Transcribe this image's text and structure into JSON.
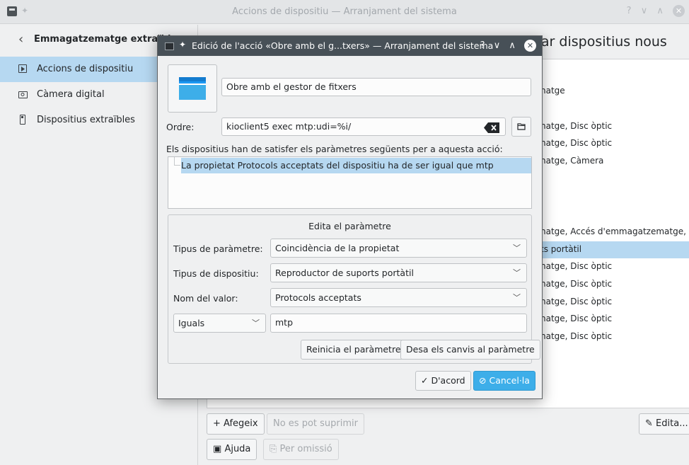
{
  "window": {
    "title": "Accions de dispositiu — Arranjament del sistema",
    "controls": {
      "help": "?",
      "minimize": "∨",
      "maximize": "∧",
      "close": "✕"
    }
  },
  "sidebar": {
    "back_title": "Emmagatzematge extraïble",
    "items": [
      {
        "label": "Accions de dispositiu",
        "selected": true
      },
      {
        "label": "Càmera digital",
        "selected": false
      },
      {
        "label": "Dispositius extraïbles",
        "selected": false
      }
    ]
  },
  "content": {
    "title": "ttar dispositius nous",
    "rows": [
      {
        "text": "natge",
        "selected": false
      },
      {
        "text": "natge, Disc òptic",
        "selected": false
      },
      {
        "text": "natge, Disc òptic",
        "selected": false
      },
      {
        "text": "natge, Càmera",
        "selected": false
      },
      {
        "text": "natge, Accés d'emmagatzematge, ...",
        "selected": false
      },
      {
        "text": "ts portàtil",
        "selected": true
      },
      {
        "text": "natge, Disc òptic",
        "selected": false
      },
      {
        "text": "natge, Disc òptic",
        "selected": false
      },
      {
        "text": "natge, Disc òptic",
        "selected": false
      },
      {
        "text": "natge, Disc òptic",
        "selected": false
      },
      {
        "text": "natge, Disc òptic",
        "selected": false
      }
    ],
    "buttons": {
      "add": "Afegeix",
      "cannot_delete": "No es pot suprimir",
      "edit": "Edita...",
      "help": "Ajuda",
      "defaults": "Per omissió"
    }
  },
  "dialog": {
    "title": "Edició de l'acció «Obre amb el g...txers» — Arranjament del sistema",
    "controls": {
      "help": "?",
      "minimize": "∨",
      "maximize": "∧",
      "close": "✕"
    },
    "action_name": "Obre amb el gestor de fitxers",
    "command_label": "Ordre:",
    "command_value": "kioclient5 exec mtp:udi=%i/",
    "conditions_label": "Els dispositius han de satisfer els paràmetres següents per a aquesta acció:",
    "condition_item": "La propietat Protocols acceptats del dispositiu ha de ser igual que mtp",
    "edit_group_title": "Edita el paràmetre",
    "param_type_label": "Tipus de paràmetre:",
    "param_type_value": "Coincidència de la propietat",
    "device_type_label": "Tipus de dispositiu:",
    "device_type_value": "Reproductor de suports portàtil",
    "value_name_label": "Nom del valor:",
    "value_name_value": "Protocols acceptats",
    "comparison_value": "Iguals",
    "match_value": "mtp",
    "reset_button": "Reinicia el paràmetre",
    "save_button": "Desa els canvis al paràmetre",
    "ok_button": "D'acord",
    "cancel_button": "Cancel·la"
  },
  "colors": {
    "selection": "#b6d8f1",
    "dialog_titlebar": "#475057",
    "primary_button": "#3daee9",
    "folder_icon": "#1d99f3"
  }
}
